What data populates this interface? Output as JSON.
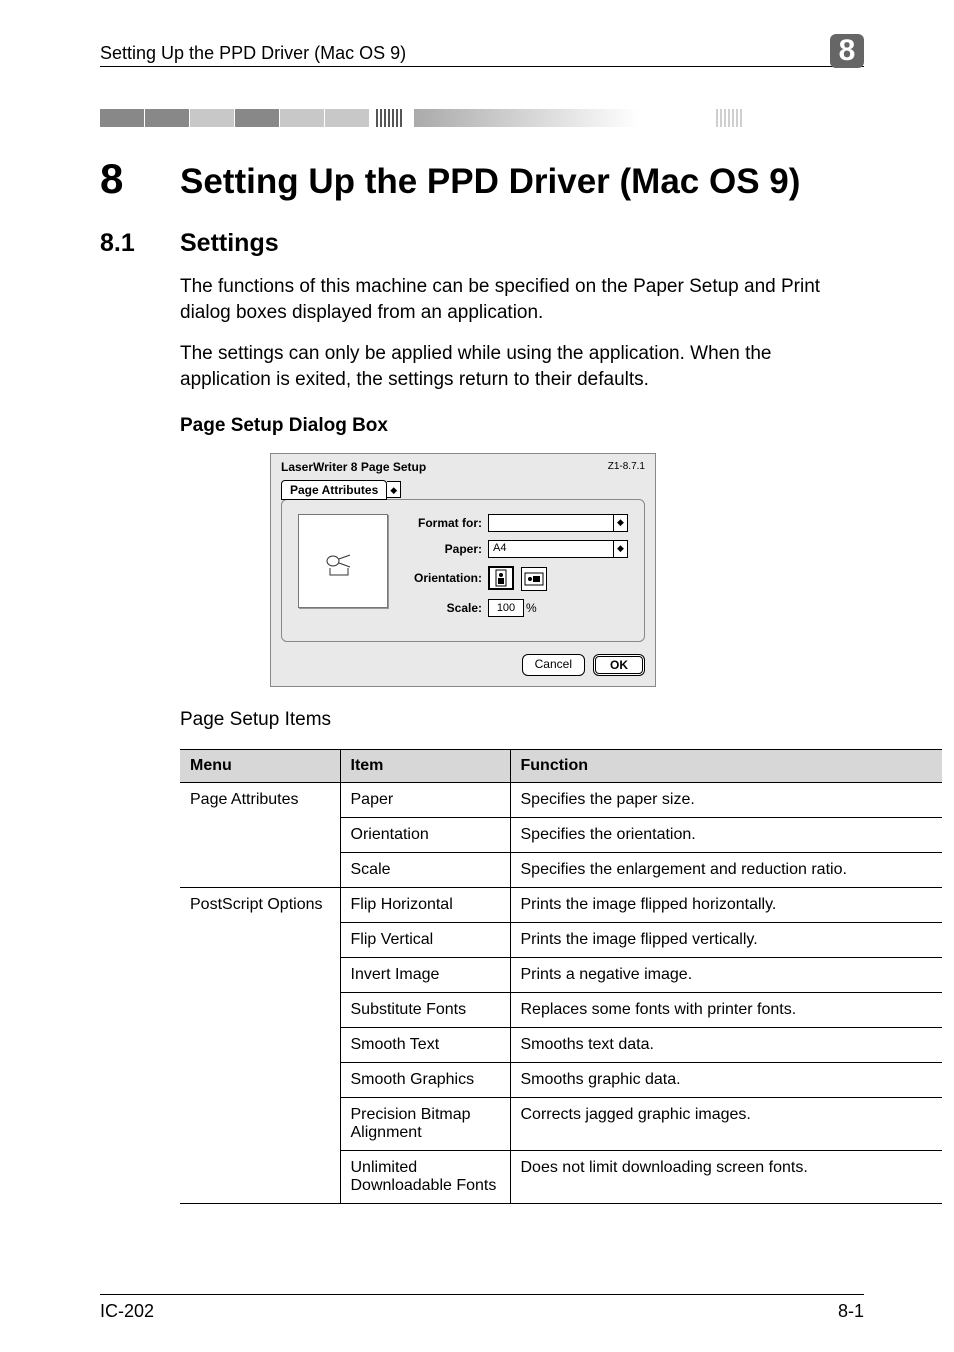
{
  "header": {
    "running_head": "Setting Up the PPD Driver (Mac OS 9)",
    "chapter_badge": "8"
  },
  "chapter": {
    "number": "8",
    "title": "Setting Up the PPD Driver (Mac OS 9)"
  },
  "section": {
    "number": "8.1",
    "title": "Settings"
  },
  "paragraphs": {
    "p1": "The functions of this machine can be specified on the Paper Setup and Print dialog boxes displayed from an application.",
    "p2": "The settings can only be applied while using the application. When the application is exited, the settings return to their defaults."
  },
  "subhead": "Page Setup Dialog Box",
  "dialog": {
    "title": "LaserWriter 8 Page Setup",
    "version": "Z1-8.7.1",
    "tab": "Page Attributes",
    "format_for_label": "Format for:",
    "format_for_value": "",
    "paper_label": "Paper:",
    "paper_value": "A4",
    "orientation_label": "Orientation:",
    "scale_label": "Scale:",
    "scale_value": "100",
    "scale_unit": "%",
    "cancel": "Cancel",
    "ok": "OK"
  },
  "table_caption": "Page Setup Items",
  "table": {
    "headers": {
      "menu": "Menu",
      "item": "Item",
      "function": "Function"
    },
    "rows": [
      {
        "menu": "Page Attributes",
        "item": "Paper",
        "function": "Specifies the paper size."
      },
      {
        "menu": "",
        "item": "Orientation",
        "function": "Specifies the orientation."
      },
      {
        "menu": "",
        "item": "Scale",
        "function": "Specifies the enlargement and reduction ratio."
      },
      {
        "menu": "PostScript Options",
        "item": "Flip Horizontal",
        "function": "Prints the image flipped horizontally."
      },
      {
        "menu": "",
        "item": "Flip Vertical",
        "function": "Prints the image flipped vertically."
      },
      {
        "menu": "",
        "item": "Invert Image",
        "function": "Prints a negative image."
      },
      {
        "menu": "",
        "item": "Substitute Fonts",
        "function": "Replaces some fonts with printer fonts."
      },
      {
        "menu": "",
        "item": "Smooth Text",
        "function": "Smooths text data."
      },
      {
        "menu": "",
        "item": "Smooth Graphics",
        "function": "Smooths graphic data."
      },
      {
        "menu": "",
        "item": "Precision Bitmap Alignment",
        "function": "Corrects jagged graphic images."
      },
      {
        "menu": "",
        "item": "Unlimited Downloadable Fonts",
        "function": "Does not limit downloading screen fonts."
      }
    ]
  },
  "footer": {
    "left": "IC-202",
    "right": "8-1"
  }
}
